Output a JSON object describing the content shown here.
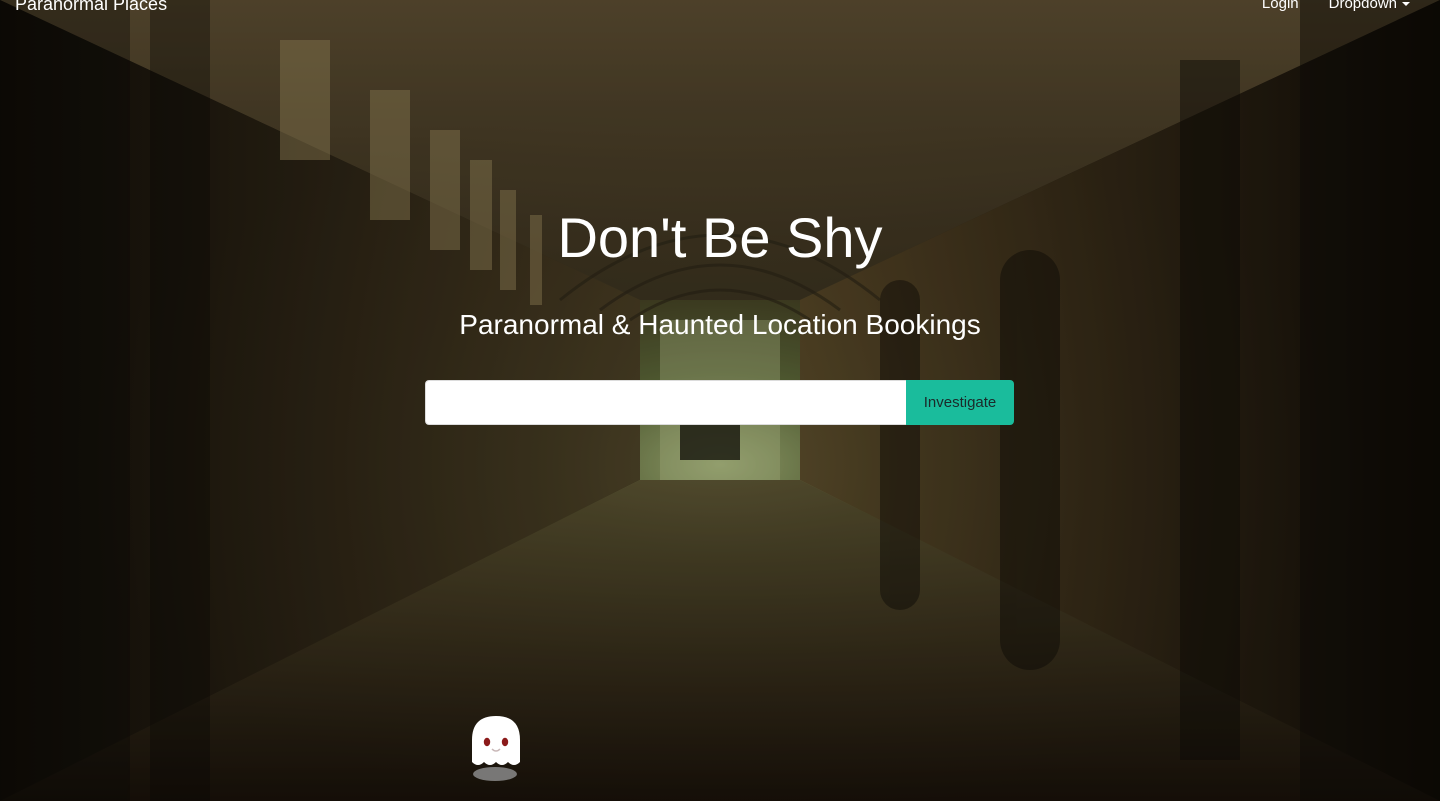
{
  "navbar": {
    "brand": "Paranormal Places",
    "links": [
      {
        "label": "Login"
      },
      {
        "label": "Dropdown"
      }
    ]
  },
  "hero": {
    "title": "Don't Be Shy",
    "subtitle": "Paranormal & Haunted Location Bookings"
  },
  "search": {
    "value": "",
    "placeholder": "",
    "button_label": "Investigate"
  },
  "colors": {
    "accent": "#1abc9c",
    "text": "#ffffff"
  },
  "icons": {
    "mascot": "ghost-icon",
    "dropdown": "caret-down-icon"
  }
}
